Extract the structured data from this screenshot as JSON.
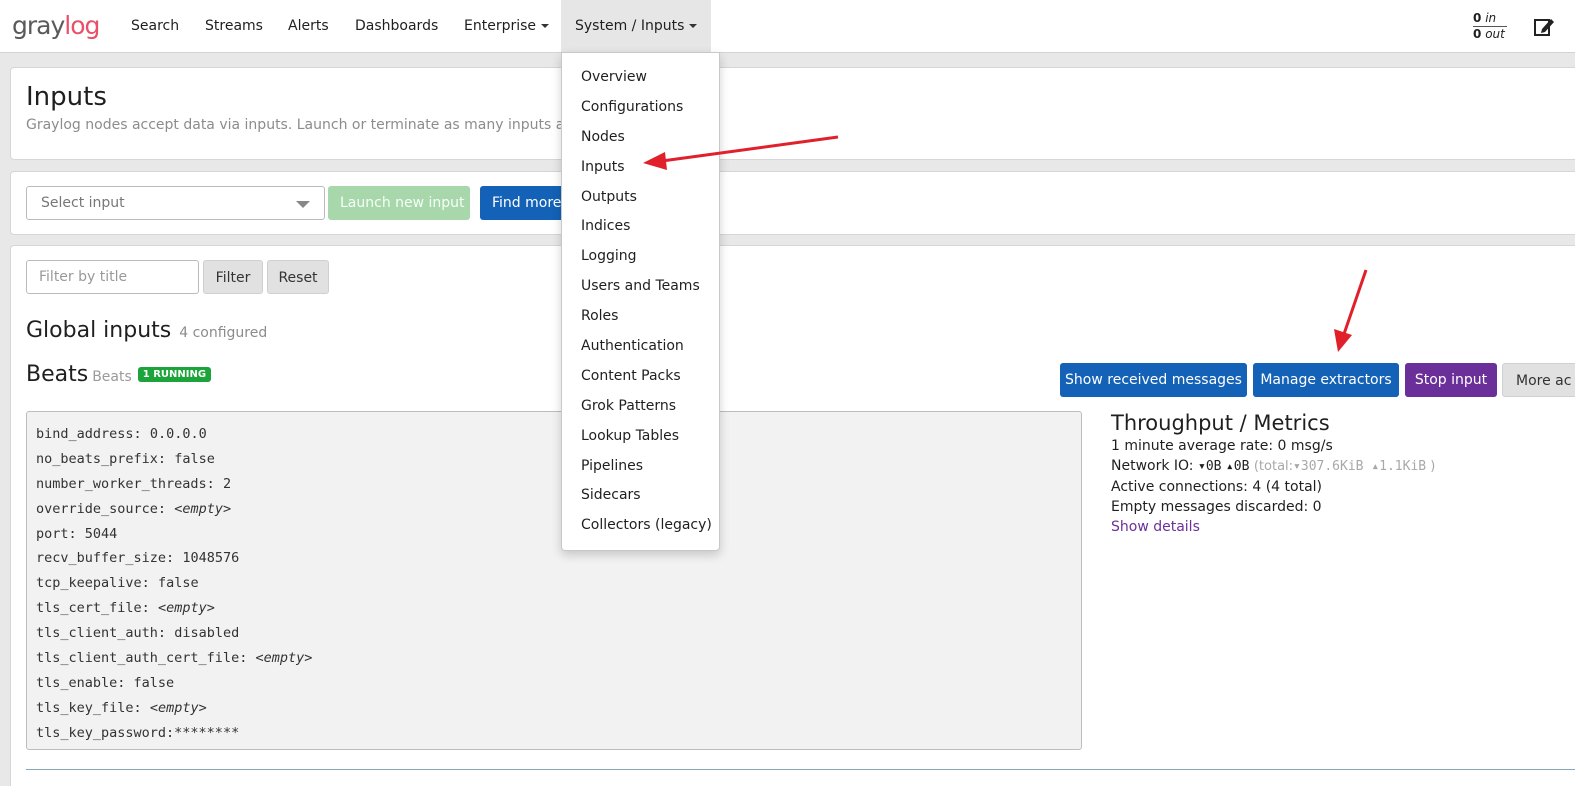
{
  "navbar": {
    "logo_part1": "gray",
    "logo_part2": "log",
    "items": [
      {
        "label": "Search"
      },
      {
        "label": "Streams"
      },
      {
        "label": "Alerts"
      },
      {
        "label": "Dashboards"
      },
      {
        "label": "Enterprise"
      },
      {
        "label": "System / Inputs"
      }
    ],
    "throughput": {
      "in_value": "0",
      "in_label": "in",
      "out_value": "0",
      "out_label": "out"
    },
    "edit_icon": "edit-icon"
  },
  "header": {
    "title": "Inputs",
    "description": "Graylog nodes accept data via inputs. Launch or terminate as many inputs as you w"
  },
  "launch": {
    "select_placeholder": "Select input",
    "launch_button": "Launch new input",
    "find_more_button": "Find more"
  },
  "filter": {
    "placeholder": "Filter by title",
    "filter_button": "Filter",
    "reset_button": "Reset"
  },
  "global_inputs": {
    "title": "Global inputs",
    "count_label": "4 configured"
  },
  "input": {
    "name": "Beats",
    "type": "Beats",
    "status_badge": "1 RUNNING",
    "actions": {
      "show_messages": "Show received messages",
      "manage_extractors": "Manage extractors",
      "stop_input": "Stop input",
      "more_actions": "More ac"
    },
    "config": [
      {
        "key": "bind_address:",
        "value": "0.0.0.0",
        "empty": false
      },
      {
        "key": "no_beats_prefix:",
        "value": "false",
        "empty": false
      },
      {
        "key": "number_worker_threads:",
        "value": "2",
        "empty": false
      },
      {
        "key": "override_source:",
        "value": "<empty>",
        "empty": true
      },
      {
        "key": "port:",
        "value": "5044",
        "empty": false
      },
      {
        "key": "recv_buffer_size:",
        "value": "1048576",
        "empty": false
      },
      {
        "key": "tcp_keepalive:",
        "value": "false",
        "empty": false
      },
      {
        "key": "tls_cert_file:",
        "value": "<empty>",
        "empty": true
      },
      {
        "key": "tls_client_auth:",
        "value": "disabled",
        "empty": false
      },
      {
        "key": "tls_client_auth_cert_file:",
        "value": "<empty>",
        "empty": true
      },
      {
        "key": "tls_enable:",
        "value": "false",
        "empty": false
      },
      {
        "key": "tls_key_file:",
        "value": "<empty>",
        "empty": true
      },
      {
        "key": "tls_key_password:",
        "value": "********",
        "empty": false
      }
    ],
    "metrics": {
      "title": "Throughput / Metrics",
      "avg_rate": "1 minute average rate: 0 msg/s",
      "network_io_label": "Network IO:",
      "network_in": "0B",
      "network_out": "0B",
      "total_prefix": "(total:",
      "total_in": "307.6KiB",
      "total_out": "1.1KiB",
      "total_suffix": ")",
      "active_connections": "Active connections: 4 (4 total)",
      "empty_discarded": "Empty messages discarded: 0",
      "show_details": "Show details"
    }
  },
  "system_menu": {
    "items": [
      "Overview",
      "Configurations",
      "Nodes",
      "Inputs",
      "Outputs",
      "Indices",
      "Logging",
      "Users and Teams",
      "Roles",
      "Authentication",
      "Content Packs",
      "Grok Patterns",
      "Lookup Tables",
      "Pipelines",
      "Sidecars",
      "Collectors (legacy)"
    ]
  },
  "colors": {
    "primary": "#1362b8",
    "success": "#1ca33a",
    "danger_arrow": "#e0202a",
    "purple": "#6b2f99",
    "brand_red": "#e9506a"
  }
}
